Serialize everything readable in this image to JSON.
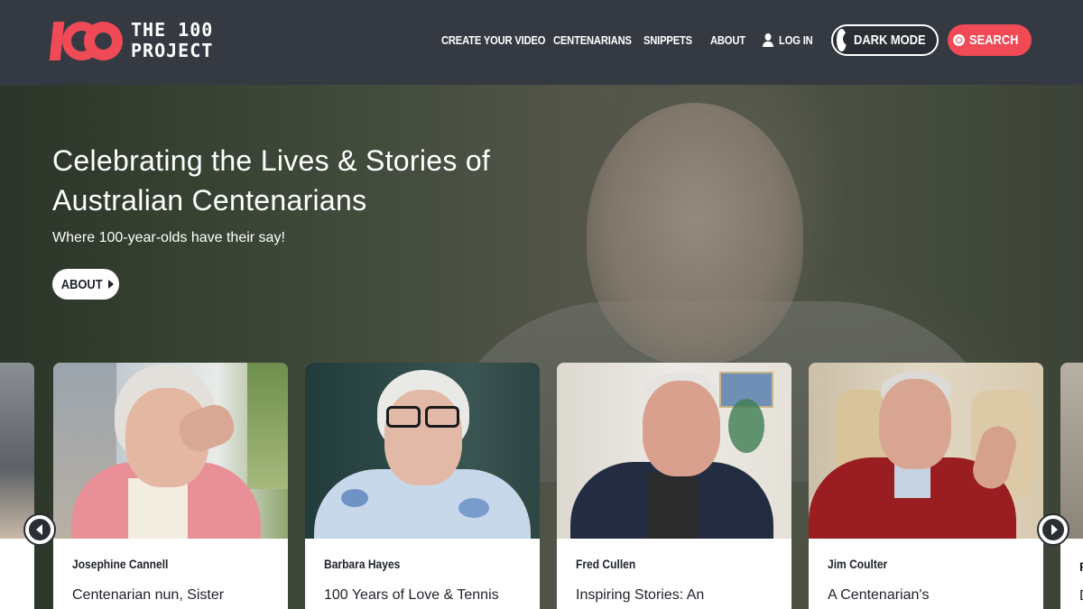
{
  "brand": {
    "line1": "THE 100",
    "line2": "PROJECT",
    "color": "#f04a57"
  },
  "nav": {
    "create": "CREATE YOUR VIDEO",
    "centenarians": "CENTENARIANS",
    "snippets": "SNIPPETS",
    "about": "ABOUT",
    "login": "LOG IN",
    "dark_mode": "DARK MODE",
    "search": "SEARCH"
  },
  "hero": {
    "title_line1": "Celebrating the Lives & Stories of",
    "title_line2": "Australian Centenarians",
    "subtitle": "Where 100-year-olds have their say!",
    "button": "ABOUT"
  },
  "cards": [
    {
      "name": "Josephine Cannell",
      "title": "Centenarian nun, Sister"
    },
    {
      "name": "Barbara Hayes",
      "title": "100 Years of Love & Tennis"
    },
    {
      "name": "Fred Cullen",
      "title": "Inspiring Stories: An"
    },
    {
      "name": "Jim Coulter",
      "title": "A Centenarian's"
    }
  ],
  "edge_card_right": {
    "name": "R",
    "title": "D"
  },
  "colors": {
    "header_bg": "#353a42",
    "accent": "#f04a57",
    "dark": "#2a2e34"
  }
}
